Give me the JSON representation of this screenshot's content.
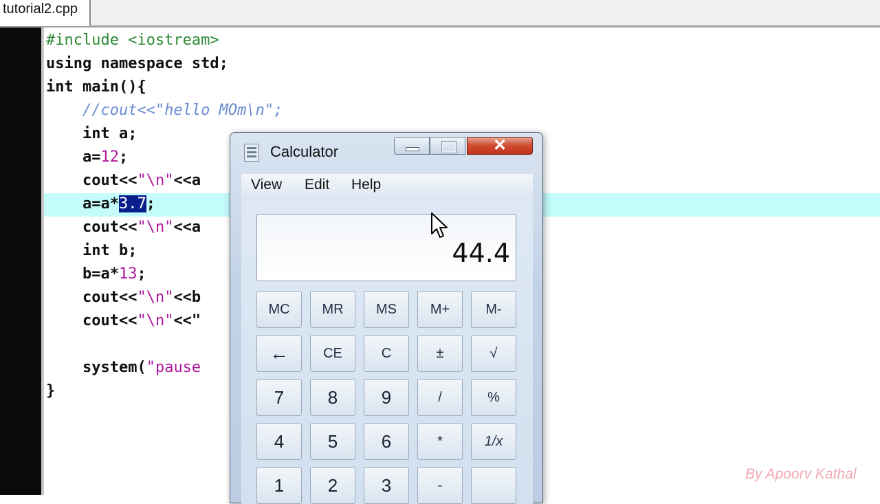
{
  "tab": {
    "filename": "tutorial2.cpp"
  },
  "code": {
    "l1": "#include <iostream>",
    "l2": "using namespace std;",
    "l3": "int main(){",
    "l4": "    //cout<<\"hello MOm\\n\";",
    "l5": "    int a;",
    "l6_a": "    a=",
    "l6_num": "12",
    "l6_end": ";",
    "l7_a": "    cout<<",
    "l7_str": "\"\\n\"",
    "l7_end": "<<a",
    "l8_a": "    a=a*",
    "l8_sel": "3.7",
    "l8_end": ";",
    "l9_a": "    cout<<",
    "l9_str": "\"\\n\"",
    "l9_end": "<<a",
    "l10": "    int b;",
    "l11_a": "    b=a*",
    "l11_num": "13",
    "l11_end": ";",
    "l12_a": "    cout<<",
    "l12_str": "\"\\n\"",
    "l12_end": "<<b",
    "l13_a": "    cout<<",
    "l13_str": "\"\\n\"",
    "l13_end": "<<\"",
    "l15_a": "    system(",
    "l15_str": "\"pause",
    "l16": "}"
  },
  "watermark": "By Apoorv Kathal",
  "calculator": {
    "title": "Calculator",
    "close_label": "✕",
    "menu": [
      "View",
      "Edit",
      "Help"
    ],
    "display": "44.4",
    "keys": [
      [
        "MC",
        "MR",
        "MS",
        "M+",
        "M-"
      ],
      [
        "←",
        "CE",
        "C",
        "±",
        "√"
      ],
      [
        "7",
        "8",
        "9",
        "/",
        "%"
      ],
      [
        "4",
        "5",
        "6",
        "*",
        "1/x"
      ],
      [
        "1",
        "2",
        "3",
        "-",
        ""
      ]
    ]
  },
  "colors": {
    "highlight_line": "#c4fbfb",
    "selection": "#0a1e8c",
    "string": "#b0179c",
    "comment": "#6a8cd6"
  }
}
